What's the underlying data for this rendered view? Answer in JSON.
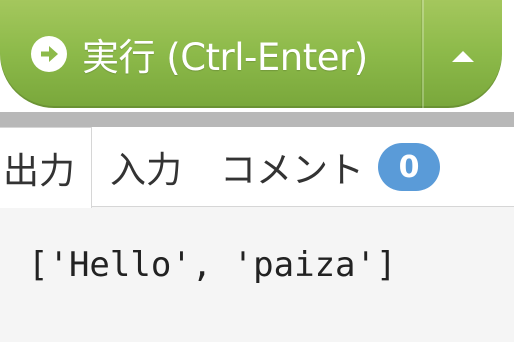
{
  "run_button": {
    "label": "実行 (Ctrl-Enter)",
    "icon": "arrow-circle-right-icon",
    "toggle_icon": "caret-up-icon"
  },
  "tabs": {
    "output_label": "出力",
    "input_label": "入力",
    "comment_label": "コメント",
    "comment_count": "0",
    "active": "output"
  },
  "output": {
    "text": "['Hello', 'paiza']"
  },
  "colors": {
    "run_button": "#8dba4a",
    "badge": "#5a9bd8",
    "separator": "#b8b8b8",
    "output_background": "#f5f5f5"
  }
}
